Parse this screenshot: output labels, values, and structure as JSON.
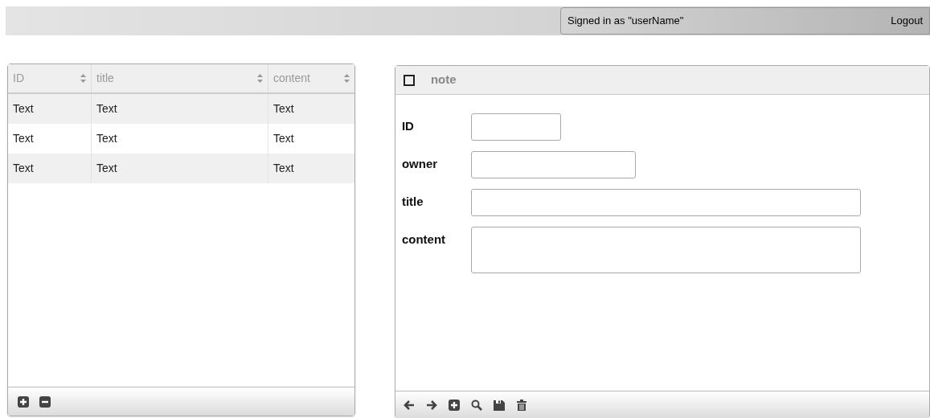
{
  "top_bar": {
    "signed_in": "Signed in as \"userName\"",
    "logout": "Logout"
  },
  "table": {
    "columns": [
      {
        "label": "ID"
      },
      {
        "label": "title"
      },
      {
        "label": "content"
      }
    ],
    "rows": [
      [
        "Text",
        "Text",
        "Text"
      ],
      [
        "Text",
        "Text",
        "Text"
      ],
      [
        "Text",
        "Text",
        "Text"
      ]
    ],
    "toolbar": [
      {
        "kind": "add"
      },
      {
        "kind": "remove"
      }
    ]
  },
  "form": {
    "title": "note",
    "checked": false,
    "fields": [
      {
        "label": "ID",
        "kind": "short"
      },
      {
        "label": "owner",
        "kind": "medium"
      },
      {
        "label": "title",
        "kind": "long"
      },
      {
        "label": "content",
        "kind": "multiline"
      }
    ],
    "toolbar": [
      {
        "kind": "back"
      },
      {
        "kind": "forward"
      },
      {
        "kind": "add"
      },
      {
        "kind": "search"
      },
      {
        "kind": "save"
      },
      {
        "kind": "delete"
      }
    ]
  }
}
